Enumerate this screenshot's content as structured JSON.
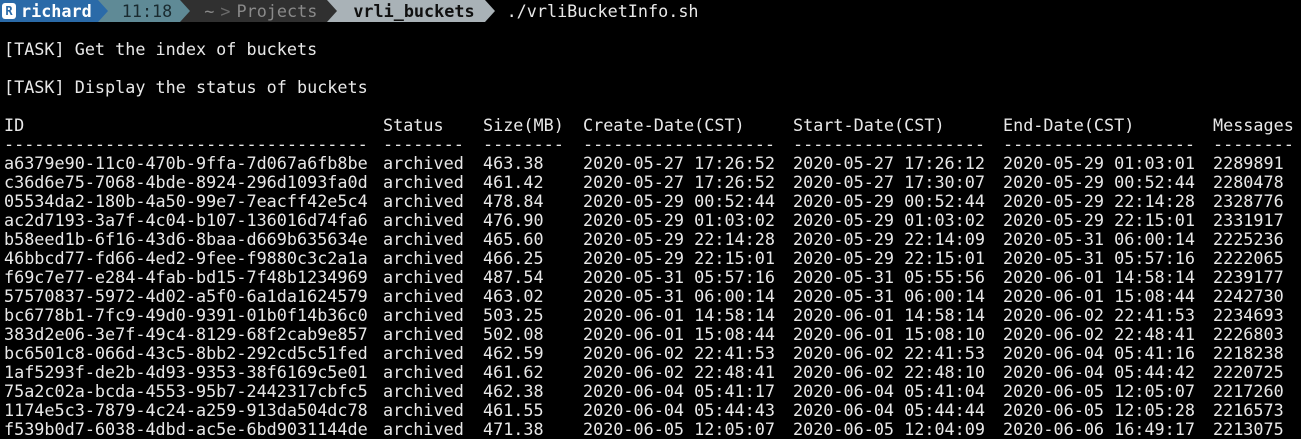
{
  "prompt": {
    "user": "richard",
    "user_badge": "R",
    "time": "11:18",
    "home": "~",
    "path_sep": ">",
    "path_mid": "Projects",
    "dir": "vrli_buckets",
    "command": "./vrliBucketInfo.sh"
  },
  "tasks": [
    "[TASK] Get the index of buckets",
    "[TASK] Display the status of buckets"
  ],
  "table": {
    "headers": [
      "ID",
      "Status",
      "Size(MB)",
      "Create-Date(CST)",
      "Start-Date(CST)",
      "End-Date(CST)",
      "Messages"
    ],
    "dividers": [
      "------------------------------------",
      "--------",
      "--------",
      "-------------------",
      "-------------------",
      "-------------------",
      "--------"
    ],
    "rows": [
      [
        "a6379e90-11c0-470b-9ffa-7d067a6fb8be",
        "archived",
        "463.38",
        "2020-05-27 17:26:52",
        "2020-05-27 17:26:12",
        "2020-05-29 01:03:01",
        "2289891"
      ],
      [
        "c36d6e75-7068-4bde-8924-296d1093fa0d",
        "archived",
        "461.42",
        "2020-05-27 17:26:52",
        "2020-05-27 17:30:07",
        "2020-05-29 00:52:44",
        "2280478"
      ],
      [
        "05534da2-180b-4a50-99e7-7eacff42e5c4",
        "archived",
        "478.84",
        "2020-05-29 00:52:44",
        "2020-05-29 00:52:44",
        "2020-05-29 22:14:28",
        "2328776"
      ],
      [
        "ac2d7193-3a7f-4c04-b107-136016d74fa6",
        "archived",
        "476.90",
        "2020-05-29 01:03:02",
        "2020-05-29 01:03:02",
        "2020-05-29 22:15:01",
        "2331917"
      ],
      [
        "b58eed1b-6f16-43d6-8baa-d669b635634e",
        "archived",
        "465.60",
        "2020-05-29 22:14:28",
        "2020-05-29 22:14:09",
        "2020-05-31 06:00:14",
        "2225236"
      ],
      [
        "46bbcd77-fd66-4ed2-9fee-f9880c3c2a1a",
        "archived",
        "466.25",
        "2020-05-29 22:15:01",
        "2020-05-29 22:15:01",
        "2020-05-31 05:57:16",
        "2222065"
      ],
      [
        "f69c7e77-e284-4fab-bd15-7f48b1234969",
        "archived",
        "487.54",
        "2020-05-31 05:57:16",
        "2020-05-31 05:55:56",
        "2020-06-01 14:58:14",
        "2239177"
      ],
      [
        "57570837-5972-4d02-a5f0-6a1da1624579",
        "archived",
        "463.02",
        "2020-05-31 06:00:14",
        "2020-05-31 06:00:14",
        "2020-06-01 15:08:44",
        "2242730"
      ],
      [
        "bc6778b1-7fc9-49d0-9391-01b0f14b36c0",
        "archived",
        "503.25",
        "2020-06-01 14:58:14",
        "2020-06-01 14:58:14",
        "2020-06-02 22:41:53",
        "2234693"
      ],
      [
        "383d2e06-3e7f-49c4-8129-68f2cab9e857",
        "archived",
        "502.08",
        "2020-06-01 15:08:44",
        "2020-06-01 15:08:10",
        "2020-06-02 22:48:41",
        "2226803"
      ],
      [
        "bc6501c8-066d-43c5-8bb2-292cd5c51fed",
        "archived",
        "462.59",
        "2020-06-02 22:41:53",
        "2020-06-02 22:41:53",
        "2020-06-04 05:41:16",
        "2218238"
      ],
      [
        "1af5293f-de2b-4d93-9353-38f6169c5e01",
        "archived",
        "461.62",
        "2020-06-02 22:48:41",
        "2020-06-02 22:48:10",
        "2020-06-04 05:44:42",
        "2220725"
      ],
      [
        "75a2c02a-bcda-4553-95b7-2442317cbfc5",
        "archived",
        "462.38",
        "2020-06-04 05:41:17",
        "2020-06-04 05:41:04",
        "2020-06-05 12:05:07",
        "2217260"
      ],
      [
        "1174e5c3-7879-4c24-a259-913da504dc78",
        "archived",
        "461.55",
        "2020-06-04 05:44:43",
        "2020-06-04 05:44:44",
        "2020-06-05 12:05:28",
        "2216573"
      ],
      [
        "f539b0d7-6038-4dbd-ac5e-6bd9031144de",
        "archived",
        "471.38",
        "2020-06-05 12:05:07",
        "2020-06-05 12:04:09",
        "2020-06-06 16:49:17",
        "2213075"
      ]
    ]
  },
  "colors": {
    "background": "#000000",
    "text": "#e8e8e8",
    "user_segment": "#2a6aa8",
    "time_segment": "#5f8a96",
    "path_segment": "#303030",
    "dir_segment": "#a9b2b7"
  }
}
